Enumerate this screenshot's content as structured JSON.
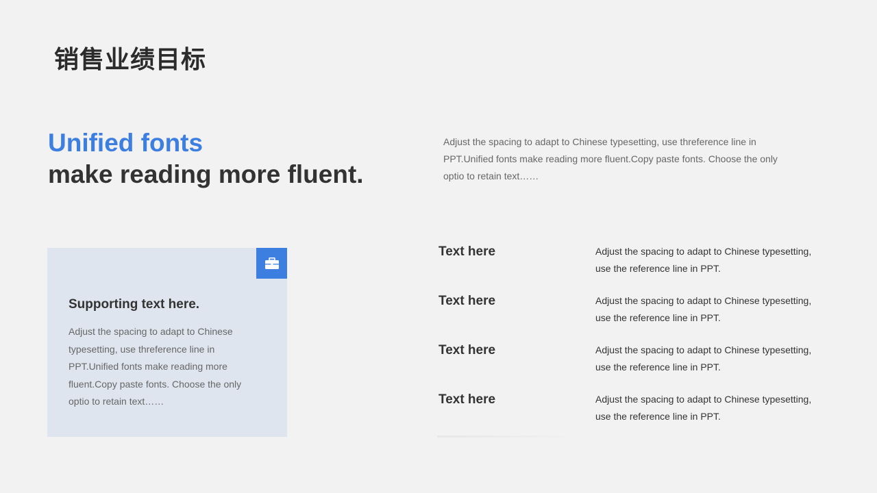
{
  "slide": {
    "title": "销售业绩目标",
    "headline": {
      "accent": "Unified fonts",
      "main": "make reading more fluent."
    },
    "intro": "Adjust the spacing to adapt to Chinese typesetting, use threference line in PPT.Unified fonts make reading more fluent.Copy paste fonts. Choose the only optio to retain text……",
    "card": {
      "icon": "briefcase-icon",
      "title": "Supporting text here.",
      "text": "Adjust the spacing to adapt to Chinese typesetting, use threference line in PPT.Unified fonts make reading more fluent.Copy paste fonts. Choose the only optio to retain text……"
    },
    "items": [
      {
        "label": "Text here",
        "desc": "Adjust the spacing to adapt to Chinese typesetting, use the reference line in PPT."
      },
      {
        "label": "Text here",
        "desc": "Adjust the spacing to adapt to Chinese typesetting, use the reference line in PPT."
      },
      {
        "label": "Text here",
        "desc": "Adjust the spacing to adapt to Chinese typesetting, use the reference line in PPT."
      },
      {
        "label": "Text here",
        "desc": "Adjust the spacing to adapt to Chinese typesetting, use the reference line in PPT."
      }
    ]
  },
  "colors": {
    "accent": "#3d7fe0",
    "background": "#f2f2f2",
    "card": "#dfe5ef"
  }
}
